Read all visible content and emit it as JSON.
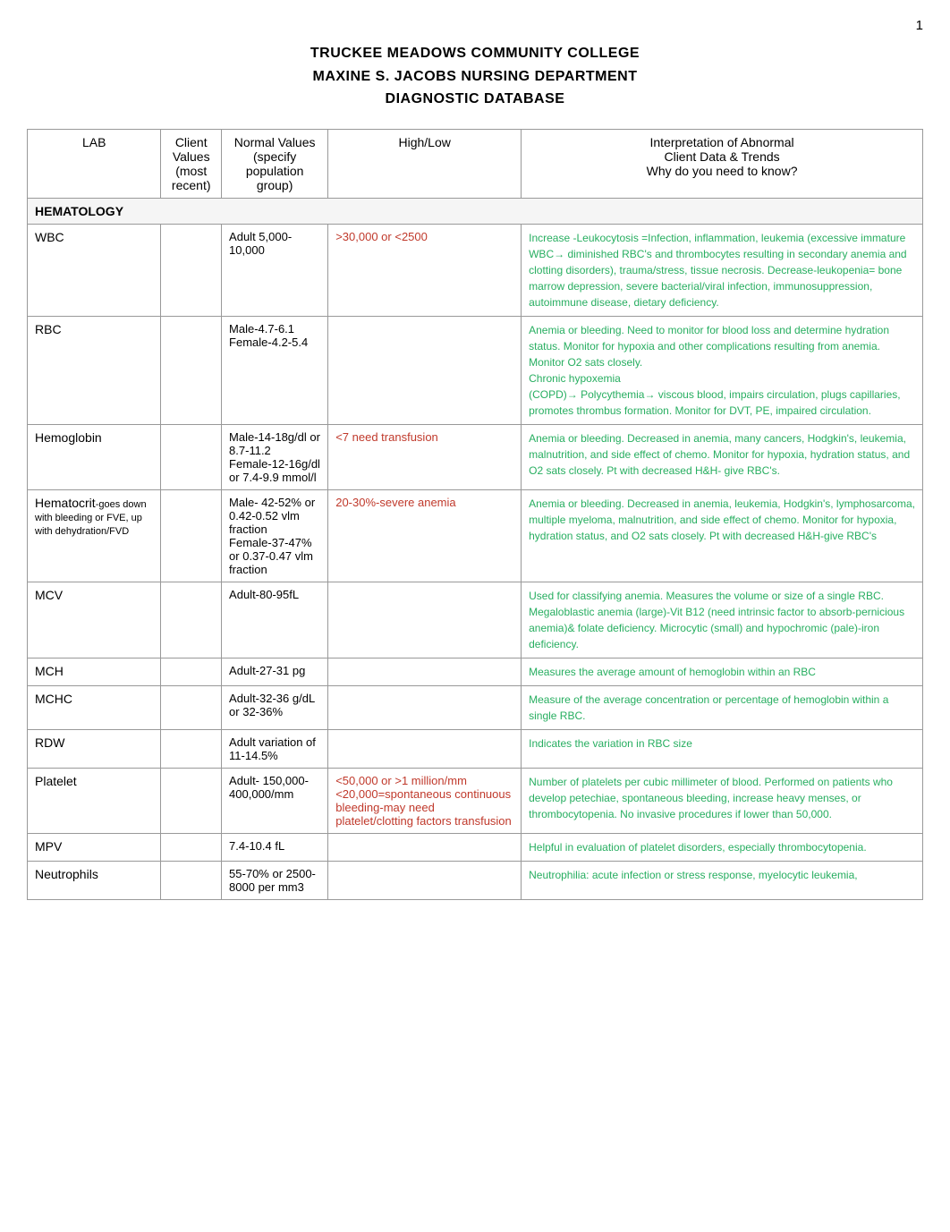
{
  "page": {
    "number": "1",
    "title_line1": "TRUCKEE MEADOWS COMMUNITY COLLEGE",
    "title_line2": "MAXINE S. JACOBS NURSING DEPARTMENT",
    "title_line3": "DIAGNOSTIC DATABASE"
  },
  "table": {
    "headers": {
      "lab": "LAB",
      "client_values": "Client Values\n(most recent)",
      "normal_values": "Normal Values\n(specify population\ngroup)",
      "high_low": "High/Low",
      "interpretation": "Interpretation of Abnormal\nClient Data & Trends\nWhy do you need to know?"
    },
    "sections": [
      {
        "name": "HEMATOLOGY",
        "rows": [
          {
            "lab": "WBC",
            "lab_sub": "",
            "client_values": "",
            "normal_values": "Adult 5,000-10,000",
            "high_low": ">30,000 or <2500",
            "interpretation": "Increase -Leukocytosis =Infection, inflammation, leukemia (excessive immature WBC→  diminished RBC's and thrombocytes resulting in secondary anemia and clotting disorders), trauma/stress, tissue necrosis. Decrease-leukopenia= bone marrow depression, severe bacterial/viral infection, immunosuppression, autoimmune disease, dietary deficiency."
          },
          {
            "lab": "RBC",
            "lab_sub": "",
            "client_values": "",
            "normal_values": "Male-4.7-6.1\nFemale-4.2-5.4",
            "high_low": "",
            "interpretation": "Anemia or bleeding. Need to monitor for blood loss and determine hydration status. Monitor for hypoxia and other complications resulting from anemia. Monitor O2 sats closely.\nChronic hypoxemia\n(COPD)→ Polycythemia→  viscous blood, impairs circulation, plugs capillaries, promotes thrombus formation. Monitor for DVT, PE, impaired circulation."
          },
          {
            "lab": "Hemoglobin",
            "lab_sub": "",
            "client_values": "",
            "normal_values": "Male-14-18g/dl or 8.7-11.2\nFemale-12-16g/dl or 7.4-9.9 mmol/l",
            "high_low": "<7 need transfusion",
            "interpretation": "Anemia or bleeding. Decreased in anemia, many cancers, Hodgkin's, leukemia, malnutrition, and side effect of chemo. Monitor for hypoxia, hydration status, and O2 sats closely. Pt with decreased H&H- give RBC's."
          },
          {
            "lab": "Hematocrit",
            "lab_sub": "goes down with bleeding or FVE, up with dehydration/FVD",
            "client_values": "",
            "normal_values": "Male- 42-52% or 0.42-0.52 vlm fraction\nFemale-37-47% or 0.37-0.47 vlm fraction",
            "high_low": "20-30%-severe anemia",
            "interpretation": "Anemia or bleeding. Decreased in anemia, leukemia, Hodgkin's, lymphosarcoma, multiple myeloma, malnutrition, and side effect of chemo. Monitor for hypoxia, hydration status, and O2 sats closely. Pt with decreased H&H-give RBC's"
          },
          {
            "lab": "MCV",
            "lab_sub": "",
            "client_values": "",
            "normal_values": "Adult-80-95fL",
            "high_low": "",
            "interpretation": "Used for classifying anemia. Measures the volume or size of a single RBC. Megaloblastic anemia (large)-Vit B12 (need intrinsic factor to absorb-pernicious anemia)& folate deficiency. Microcytic (small) and hypochromic (pale)-iron deficiency."
          },
          {
            "lab": "MCH",
            "lab_sub": "",
            "client_values": "",
            "normal_values": "Adult-27-31 pg",
            "high_low": "",
            "interpretation": "Measures the average amount of hemoglobin within an RBC"
          },
          {
            "lab": "MCHC",
            "lab_sub": "",
            "client_values": "",
            "normal_values": "Adult-32-36 g/dL or 32-36%",
            "high_low": "",
            "interpretation": "Measure of the average concentration or percentage of hemoglobin within a single RBC."
          },
          {
            "lab": "RDW",
            "lab_sub": "",
            "client_values": "",
            "normal_values": "Adult variation of 11-14.5%",
            "high_low": "",
            "interpretation": "Indicates the variation in RBC size"
          },
          {
            "lab": "Platelet",
            "lab_sub": "",
            "client_values": "",
            "normal_values": "Adult- 150,000-400,000/mm",
            "high_low": "<50,000 or >1 million/mm\n<20,000=spontaneous continuous bleeding-may need platelet/clotting factors transfusion",
            "interpretation": "Number of platelets per cubic millimeter of blood. Performed on patients who develop petechiae, spontaneous bleeding, increase heavy menses, or thrombocytopenia. No invasive procedures if lower than 50,000."
          },
          {
            "lab": "MPV",
            "lab_sub": "",
            "client_values": "",
            "normal_values": "7.4-10.4 fL",
            "high_low": "",
            "interpretation": "Helpful in evaluation of platelet disorders, especially thrombocytopenia."
          },
          {
            "lab": "Neutrophils",
            "lab_sub": "",
            "client_values": "",
            "normal_values": "55-70% or 2500-8000 per mm3",
            "high_low": "",
            "interpretation": "Neutrophilia: acute infection or stress response, myelocytic leukemia,"
          }
        ]
      }
    ]
  }
}
